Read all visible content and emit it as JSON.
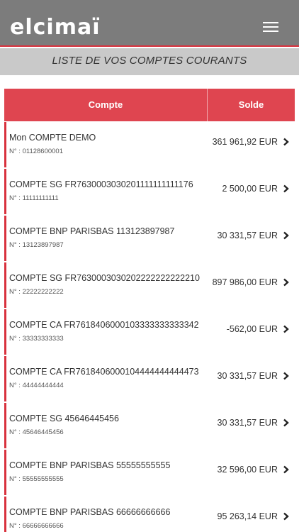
{
  "header": {
    "brand": "elcimaï",
    "menu_icon": "hamburger-menu-icon"
  },
  "page": {
    "title": "LISTE DE VOS COMPTES COURANTS"
  },
  "table": {
    "columns": [
      "Compte",
      "Solde"
    ],
    "rows": [
      {
        "name": "Mon COMPTE DEMO",
        "number": "N° : 01128600001",
        "balance": "361 961,92  EUR"
      },
      {
        "name": "COMPTE SG FR7630003030201111111111176",
        "number": "N° : 11111111111",
        "balance": "2 500,00  EUR"
      },
      {
        "name": "COMPTE BNP PARISBAS 113123897987",
        "number": "N° : 13123897987",
        "balance": "30 331,57  EUR"
      },
      {
        "name": "COMPTE SG FR7630003030202222222222210",
        "number": "N° : 22222222222",
        "balance": "897 986,00  EUR"
      },
      {
        "name": "COMPTE CA FR7618406000103333333333342",
        "number": "N° : 33333333333",
        "balance": "-562,00  EUR"
      },
      {
        "name": "COMPTE CA FR7618406000104444444444473",
        "number": "N° : 44444444444",
        "balance": "30 331,57  EUR"
      },
      {
        "name": "COMPTE SG 45646445456",
        "number": "N° : 45646445456",
        "balance": "30 331,57  EUR"
      },
      {
        "name": "COMPTE BNP PARISBAS 55555555555",
        "number": "N° : 55555555555",
        "balance": "32 596,00  EUR"
      },
      {
        "name": "COMPTE BNP PARISBAS 66666666666",
        "number": "N° : 66666666666",
        "balance": "95 263,14  EUR"
      }
    ]
  },
  "colors": {
    "topbar": "#7c7c7c",
    "accent": "#d8313d",
    "table_header": "#df4550",
    "subbar": "#c9c9c9"
  }
}
